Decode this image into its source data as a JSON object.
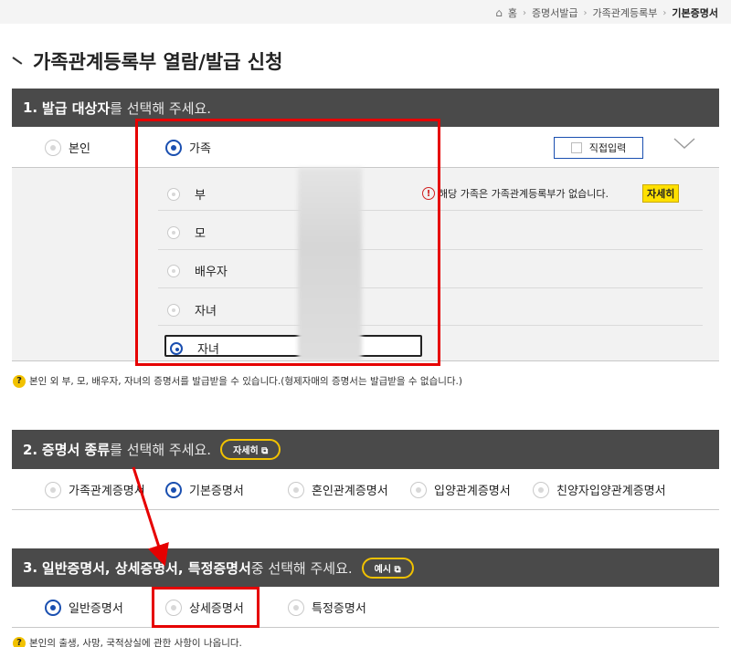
{
  "breadcrumb": {
    "home": "홈",
    "items": [
      "증명서발급",
      "가족관계등록부",
      "기본증명서"
    ]
  },
  "page_title": "가족관계등록부 열람/발급 신청",
  "section1": {
    "num": "1.",
    "bold": "발급 대상자",
    "rest": "를 선택해 주세요.",
    "options": {
      "self": "본인",
      "family": "가족"
    },
    "direct_input": "직접입력",
    "family_members": [
      "부",
      "모",
      "배우자",
      "자녀",
      "자녀"
    ],
    "notice": "해당 가족은 가족관계등록부가 없습니다.",
    "detail_label": "자세히",
    "help": "본인 외 부, 모, 배우자, 자녀의 증명서를 발급받을 수 있습니다.(형제자매의 증명서는 발급받을 수 없습니다.)"
  },
  "section2": {
    "num": "2.",
    "bold": "증명서 종류",
    "rest": "를 선택해 주세요.",
    "pill": "자세히",
    "options": [
      "가족관계증명서",
      "기본증명서",
      "혼인관계증명서",
      "입양관계증명서",
      "친양자입양관계증명서"
    ]
  },
  "section3": {
    "num": "3.",
    "bold": "일반증명서, 상세증명서, 특정증명서",
    "rest": " 중 선택해 주세요.",
    "pill": "예시",
    "options": [
      "일반증명서",
      "상세증명서",
      "특정증명서"
    ],
    "help": "본인의 출생, 사망, 국적상실에 관한 사항이 나옵니다."
  },
  "colors": {
    "header": "#4a4a4a",
    "accent": "#1a4fb0",
    "highlight": "#e60000",
    "badge": "#ffe000"
  }
}
